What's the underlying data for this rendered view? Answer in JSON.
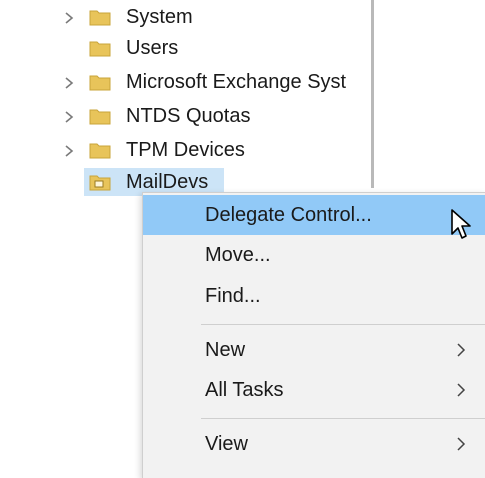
{
  "tree": {
    "items": [
      {
        "label": "System",
        "expandable": true,
        "selected": false
      },
      {
        "label": "Users",
        "expandable": false,
        "selected": false
      },
      {
        "label": "Microsoft Exchange Syst",
        "expandable": true,
        "selected": false
      },
      {
        "label": "NTDS Quotas",
        "expandable": true,
        "selected": false
      },
      {
        "label": "TPM Devices",
        "expandable": true,
        "selected": false
      },
      {
        "label": "MailDevs",
        "expandable": false,
        "selected": true
      }
    ]
  },
  "context_menu": {
    "items": [
      {
        "label": "Delegate Control...",
        "highlighted": true,
        "has_submenu": false
      },
      {
        "label": "Move...",
        "highlighted": false,
        "has_submenu": false
      },
      {
        "label": "Find...",
        "highlighted": false,
        "has_submenu": false
      },
      {
        "label": "New",
        "highlighted": false,
        "has_submenu": true
      },
      {
        "label": "All Tasks",
        "highlighted": false,
        "has_submenu": true
      },
      {
        "label": "View",
        "highlighted": false,
        "has_submenu": true
      }
    ]
  },
  "colors": {
    "folder": "#e8c45a",
    "selection": "#cce4f7",
    "menu_highlight": "#91c9f7",
    "menu_background": "#f2f2f2"
  },
  "icons": {
    "expander": "chevron-right-icon",
    "folder": "folder-icon",
    "ou_folder": "ou-folder-icon",
    "submenu": "submenu-arrow-icon",
    "cursor": "mouse-cursor-icon"
  }
}
